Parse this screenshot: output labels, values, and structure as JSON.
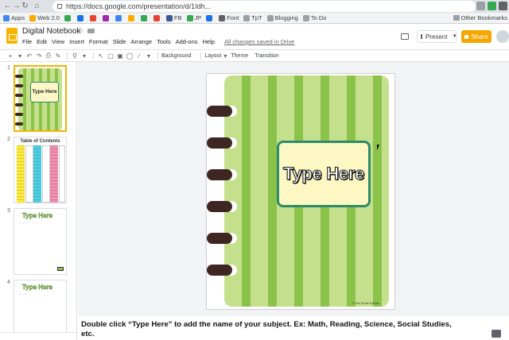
{
  "browser": {
    "url": "https://docs.google.com/presentation/d/1Idh...",
    "bookmarks": [
      {
        "label": "Apps",
        "color": "#4285f4"
      },
      {
        "label": "Web 2.0",
        "color": "#f9ab00"
      },
      {
        "label": "",
        "color": "#34a853"
      },
      {
        "label": "",
        "color": "#1a73e8"
      },
      {
        "label": "",
        "color": "#ea4335"
      },
      {
        "label": "",
        "color": "#9c27b0"
      },
      {
        "label": "",
        "color": "#4285f4"
      },
      {
        "label": "",
        "color": "#f9ab00"
      },
      {
        "label": "",
        "color": "#34a853"
      },
      {
        "label": "",
        "color": "#ea4335"
      },
      {
        "label": "FB",
        "color": "#3b5998"
      },
      {
        "label": "JP",
        "color": "#34a853"
      },
      {
        "label": "",
        "color": "#1a73e8"
      },
      {
        "label": "Font",
        "color": "#5f6368"
      },
      {
        "label": "TpT",
        "color": "#9aa0a6"
      },
      {
        "label": "Blogging",
        "color": "#9aa0a6"
      },
      {
        "label": "To Do",
        "color": "#9aa0a6"
      }
    ],
    "other_bookmarks": "Other Bookmarks"
  },
  "doc": {
    "title": "Digital Notebook",
    "menu": [
      "File",
      "Edit",
      "View",
      "Insert",
      "Format",
      "Slide",
      "Arrange",
      "Tools",
      "Add-ons",
      "Help"
    ],
    "saved_status": "All changes saved in Drive",
    "present_label": "Present",
    "share_label": "Share"
  },
  "toolbar": {
    "background_label": "Background",
    "layout_label": "Layout",
    "theme_label": "Theme",
    "transition_label": "Transition"
  },
  "filmstrip": {
    "slides": [
      {
        "number": "1",
        "label": "Type Here"
      },
      {
        "number": "2",
        "title": "Table of Contents"
      },
      {
        "number": "3",
        "heading": "Type Here"
      },
      {
        "number": "4",
        "heading": "Type Here"
      }
    ],
    "toc_colors": [
      "#ffeb3b",
      "#4dd0e1",
      "#f48fb1"
    ]
  },
  "slide": {
    "label_text": "Type Here",
    "credit": "© The Techie Teacher",
    "stripe_light": "#c5e08c",
    "stripe_dark": "#8bc34a",
    "ring_color": "#3e2723",
    "label_border": "#2e8b6a",
    "label_fill": "#fdf8c3"
  },
  "caption": {
    "text": "Double click “Type Here” to add the name of your subject. Ex: Math, Reading, Science, Social Studies, etc."
  }
}
